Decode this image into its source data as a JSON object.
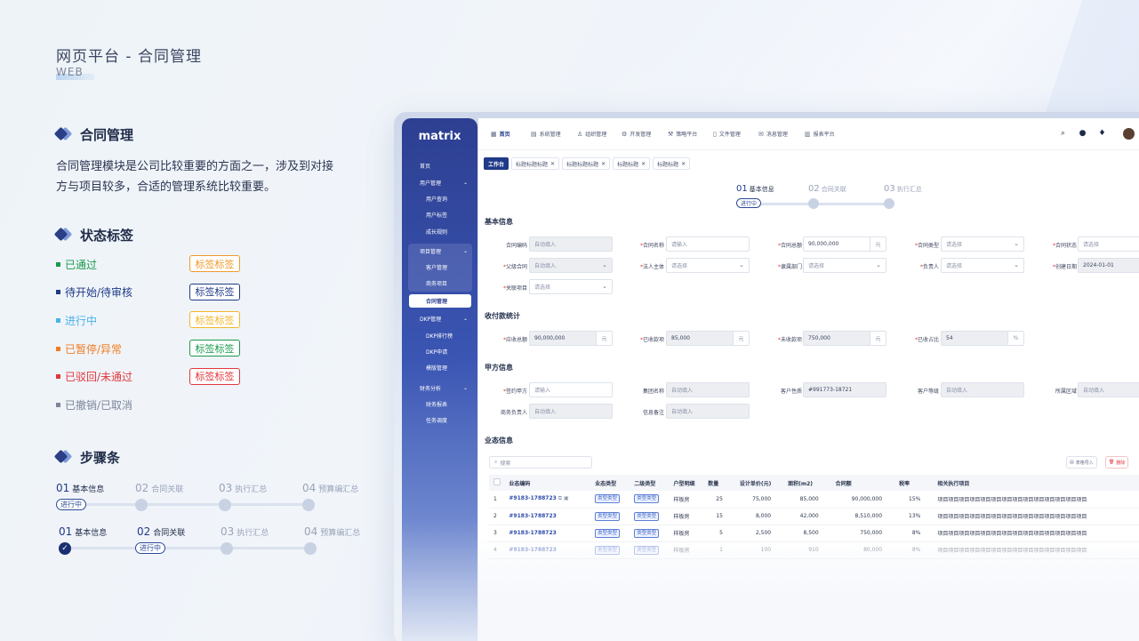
{
  "page": {
    "title": "网页平台 - 合同管理",
    "subtitle": "WEB"
  },
  "section1": {
    "title": "合同管理",
    "desc": "合同管理模块是公司比较重要的方面之一，涉及到对接方与项目较多，合适的管理系统比较重要。"
  },
  "section2": {
    "title": "状态标签",
    "statuses": [
      {
        "label": "已通过",
        "color": "#1a9a4d",
        "tag": "标签标签",
        "tag_color": "#f19a2b"
      },
      {
        "label": "待开始/待审核",
        "color": "#1f3a88",
        "tag": "标签标签",
        "tag_color": "#1f3a88"
      },
      {
        "label": "进行中",
        "color": "#4ab3e8",
        "tag": "标签标签",
        "tag_color": "#f3b62b"
      },
      {
        "label": "已暂停/异常",
        "color": "#f07c22",
        "tag": "标签标签",
        "tag_color": "#1a9a4d"
      },
      {
        "label": "已驳回/未通过",
        "color": "#e0373c",
        "tag": "标签标签",
        "tag_color": "#e0373c"
      },
      {
        "label": "已撤销/已取消",
        "color": "#7d8599",
        "tag": "",
        "tag_color": ""
      }
    ]
  },
  "section3": {
    "title": "步骤条",
    "row1": {
      "steps": [
        {
          "num": "01",
          "label": "基本信息"
        },
        {
          "num": "02",
          "label": "合同关联"
        },
        {
          "num": "03",
          "label": "执行汇总"
        },
        {
          "num": "04",
          "label": "预算编汇总"
        }
      ],
      "pill": "进行中"
    },
    "row2": {
      "steps": [
        {
          "num": "01",
          "label": "基本信息"
        },
        {
          "num": "02",
          "label": "合同关联"
        },
        {
          "num": "03",
          "label": "执行汇总"
        },
        {
          "num": "04",
          "label": "预算编汇总"
        }
      ],
      "pill": "进行中",
      "check": "✓"
    }
  },
  "app": {
    "logo": "matrix",
    "sidebar": [
      "首页",
      "用户管理",
      "用户查询",
      "用户标签",
      "成长规则",
      "项目管理",
      "客户管理",
      "商务项目",
      "合同管理",
      "DKP管理",
      "DKP排行榜",
      "DKP申请",
      "模版管理",
      "财务分析",
      "财务报表",
      "任务调度"
    ],
    "topnav": [
      {
        "icon": "▦",
        "label": "首页"
      },
      {
        "icon": "▤",
        "label": "系统管理"
      },
      {
        "icon": "♙",
        "label": "组织管理"
      },
      {
        "icon": "⚙",
        "label": "开发管理"
      },
      {
        "icon": "⚒",
        "label": "策略平台"
      },
      {
        "icon": "▯",
        "label": "文件管理"
      },
      {
        "icon": "✉",
        "label": "消息管理"
      },
      {
        "icon": "▥",
        "label": "报表平台"
      }
    ],
    "tabs": [
      {
        "label": "工作台",
        "close": ""
      },
      {
        "label": "标题标题标题",
        "close": "✕"
      },
      {
        "label": "标题标题标题",
        "close": "✕"
      },
      {
        "label": "标题标题",
        "close": "✕"
      },
      {
        "label": "标题标题",
        "close": "✕"
      }
    ],
    "steps": [
      {
        "num": "01",
        "label": "基本信息"
      },
      {
        "num": "02",
        "label": "合同关联"
      },
      {
        "num": "03",
        "label": "执行汇总"
      }
    ],
    "step_pill": "进行中",
    "basic": {
      "title": "基本信息",
      "fields": [
        {
          "label": "合同编码",
          "req": "",
          "value": "自动填入"
        },
        {
          "label": "合同名称",
          "req": "*",
          "value": "请输入"
        },
        {
          "label": "合同总额",
          "req": "*",
          "value": "90,000,000",
          "suffix": "元"
        },
        {
          "label": "合同类型",
          "req": "*",
          "value": "请选择"
        },
        {
          "label": "合同状态",
          "req": "*",
          "value": "请选择"
        },
        {
          "label": "父级合同",
          "req": "*",
          "value": "自动填入"
        },
        {
          "label": "法人主体",
          "req": "*",
          "value": "请选择"
        },
        {
          "label": "隶属部门",
          "req": "*",
          "value": "请选择"
        },
        {
          "label": "负责人",
          "req": "*",
          "value": "请选择"
        },
        {
          "label": "创建日期",
          "req": "*",
          "value": "2024-01-01"
        },
        {
          "label": "关联项目",
          "req": "*",
          "value": "请选择"
        }
      ]
    },
    "payment": {
      "title": "收付款统计",
      "fields": [
        {
          "label": "应收总额",
          "req": "*",
          "value": "90,000,000",
          "suffix": "元"
        },
        {
          "label": "已收款项",
          "req": "*",
          "value": "85,000",
          "suffix": "元"
        },
        {
          "label": "未收款项",
          "req": "*",
          "value": "750,000",
          "suffix": "元"
        },
        {
          "label": "已收占比",
          "req": "*",
          "value": "54",
          "suffix": "%"
        }
      ]
    },
    "partyA": {
      "title": "甲方信息",
      "fields": [
        {
          "label": "签约甲方",
          "req": "*",
          "value": "请输入"
        },
        {
          "label": "集团名称",
          "req": "",
          "value": "自动填入"
        },
        {
          "label": "客户性质",
          "req": "",
          "value": "#991773-18721"
        },
        {
          "label": "客户等级",
          "req": "",
          "value": "自动填入"
        },
        {
          "label": "所属区域",
          "req": "",
          "value": "自动填入"
        },
        {
          "label": "商务负责人",
          "req": "",
          "value": "自动填入"
        },
        {
          "label": "信息备注",
          "req": "",
          "value": "自动填入"
        }
      ]
    },
    "business": {
      "title": "业态信息",
      "search": "搜索",
      "btn_import": "表格导入",
      "btn_delete": "删除",
      "headers": [
        "",
        "业态编码",
        "业态类型",
        "二级类型",
        "户型明细",
        "数量",
        "设计单价(元)",
        "面积(m2)",
        "合同额",
        "税率",
        "相关执行项目"
      ],
      "rows": [
        [
          "1",
          "#9183-1788723",
          "类型类型",
          "类型类型",
          "样板房",
          "25",
          "75,000",
          "85,000",
          "90,000,000",
          "15%",
          "项目项目项目项目项目项目项目项目项目项目项目项目项目项目"
        ],
        [
          "2",
          "#9183-1788723",
          "类型类型",
          "类型类型",
          "样板房",
          "15",
          "8,000",
          "42,000",
          "8,510,000",
          "13%",
          "项目项目项目项目项目项目项目项目项目项目项目项目项目项目"
        ],
        [
          "3",
          "#9183-1788723",
          "类型类型",
          "类型类型",
          "样板房",
          "5",
          "2,500",
          "8,500",
          "750,000",
          "8%",
          "项目项目项目项目项目项目项目项目项目项目项目项目项目项目"
        ],
        [
          "4",
          "#9183-1788723",
          "类型类型",
          "类型类型",
          "样板房",
          "1",
          "100",
          "910",
          "80,000",
          "8%",
          "项目项目项目项目项目项目项目项目项目项目项目项目项目项目"
        ]
      ]
    }
  }
}
